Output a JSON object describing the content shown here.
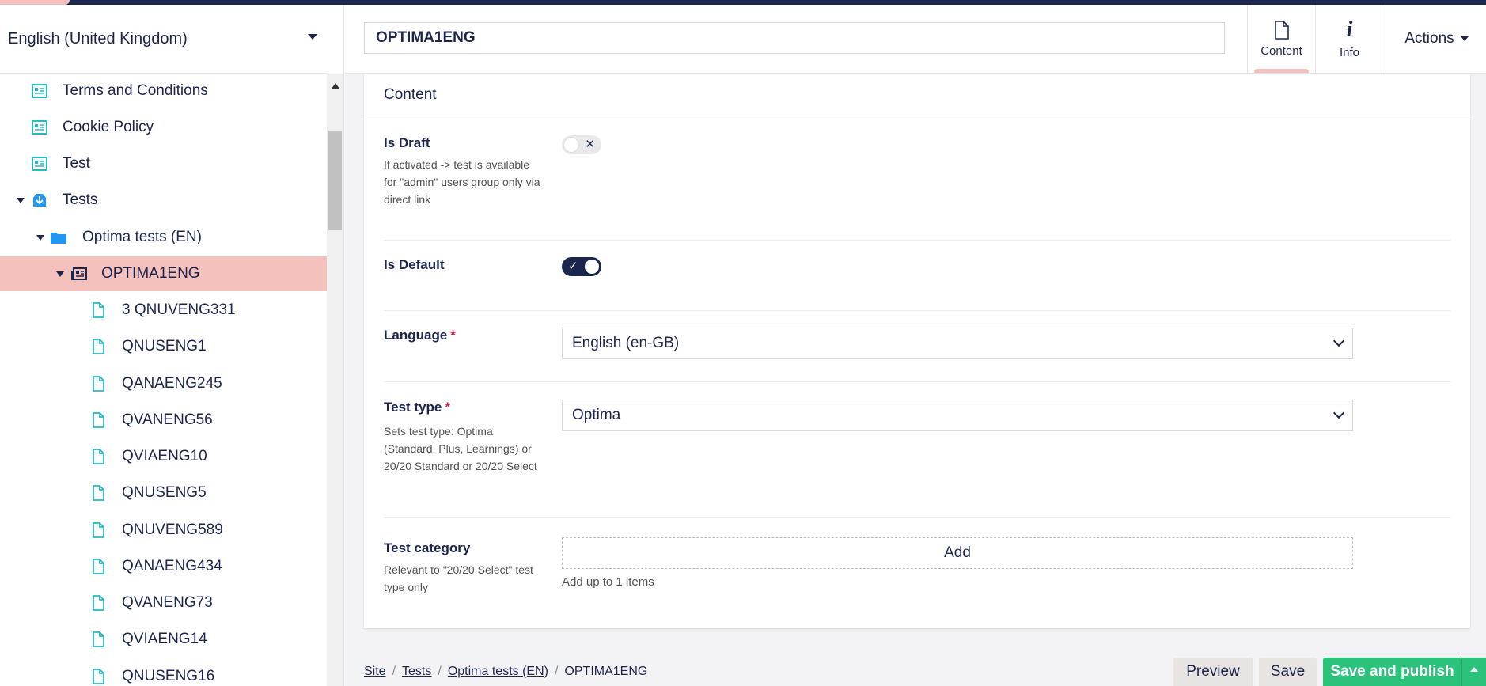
{
  "language_selector": {
    "value": "English (United Kingdom)"
  },
  "tree": {
    "items": [
      {
        "label": "Terms and Conditions",
        "icon": "document-list-icon"
      },
      {
        "label": "Cookie Policy",
        "icon": "document-list-icon"
      },
      {
        "label": "Test",
        "icon": "document-list-icon"
      },
      {
        "label": "Tests",
        "icon": "inbox-icon",
        "expanded": true
      },
      {
        "label": "Optima tests (EN)",
        "icon": "folder-icon",
        "expanded": true
      },
      {
        "label": "OPTIMA1ENG",
        "icon": "newspaper-icon",
        "expanded": true,
        "selected": true
      },
      {
        "label": "3 QNUVENG331",
        "icon": "document-icon"
      },
      {
        "label": "QNUSENG1",
        "icon": "document-icon"
      },
      {
        "label": "QANAENG245",
        "icon": "document-icon"
      },
      {
        "label": "QVANENG56",
        "icon": "document-icon"
      },
      {
        "label": "QVIAENG10",
        "icon": "document-icon"
      },
      {
        "label": "QNUSENG5",
        "icon": "document-icon"
      },
      {
        "label": "QNUVENG589",
        "icon": "document-icon"
      },
      {
        "label": "QANAENG434",
        "icon": "document-icon"
      },
      {
        "label": "QVANENG73",
        "icon": "document-icon"
      },
      {
        "label": "QVIAENG14",
        "icon": "document-icon"
      },
      {
        "label": "QNUSENG16",
        "icon": "document-icon"
      }
    ]
  },
  "header": {
    "node_name": "OPTIMA1ENG",
    "tabs": [
      {
        "label": "Content",
        "icon": "document-icon",
        "active": true
      },
      {
        "label": "Info",
        "icon": "info-icon",
        "active": false
      }
    ],
    "actions_label": "Actions"
  },
  "content": {
    "group_title": "Content",
    "is_draft": {
      "label": "Is Draft",
      "description": "If activated -> test is available for \"admin\" users group only via direct link",
      "value": false
    },
    "is_default": {
      "label": "Is Default",
      "value": true
    },
    "language": {
      "label": "Language",
      "required_mark": "*",
      "value": "English (en-GB)"
    },
    "test_type": {
      "label": "Test type",
      "required_mark": "*",
      "description": "Sets test type: Optima (Standard, Plus, Learnings) or 20/20 Standard or 20/20 Select",
      "value": "Optima"
    },
    "test_category": {
      "label": "Test category",
      "description": "Relevant to \"20/20 Select\" test type only",
      "add_label": "Add",
      "hint": "Add up to 1 items"
    }
  },
  "footer": {
    "breadcrumbs": [
      "Site",
      "Tests",
      "Optima tests (EN)",
      "OPTIMA1ENG"
    ],
    "separator": "/",
    "preview_label": "Preview",
    "save_label": "Save",
    "save_publish_label": "Save and publish"
  },
  "colors": {
    "navy": "#1b264f",
    "selection": "#f5c1bc",
    "green": "#2bc37c",
    "teal_icon": "#2bb7c4"
  }
}
